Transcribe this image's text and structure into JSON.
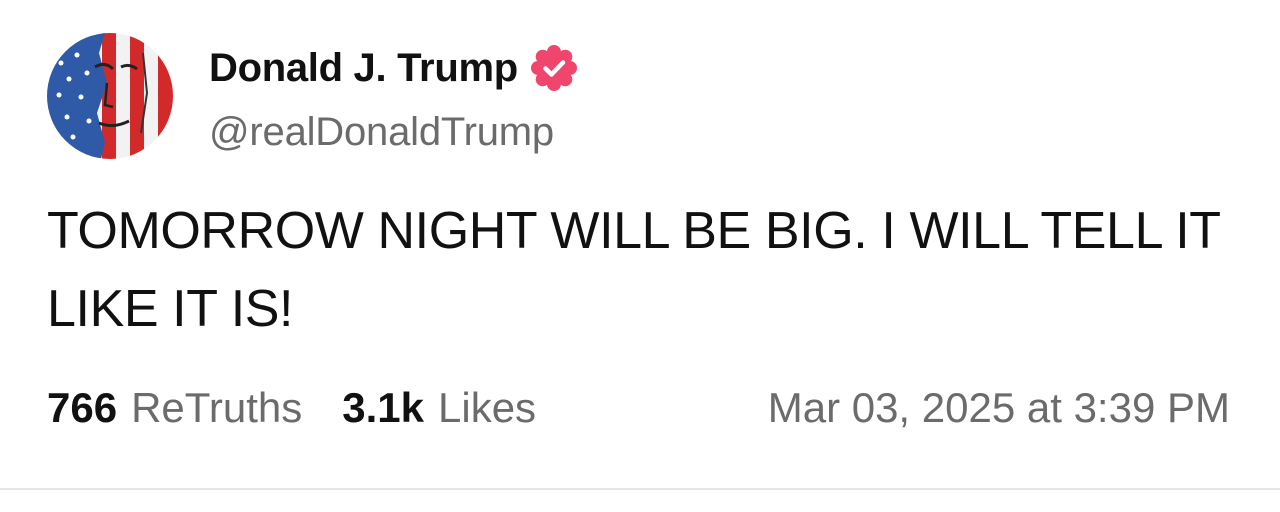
{
  "author": {
    "display_name": "Donald J. Trump",
    "handle": "@realDonaldTrump",
    "verified": true,
    "verified_color": "#f0466e",
    "avatar_icon": "flag-portrait-avatar"
  },
  "post": {
    "text": "TOMORROW NIGHT WILL BE BIG. I WILL TELL IT LIKE IT IS!"
  },
  "stats": {
    "retruths_count": "766",
    "retruths_label": "ReTruths",
    "likes_count": "3.1k",
    "likes_label": "Likes",
    "timestamp": "Mar 03, 2025 at 3:39 PM"
  }
}
